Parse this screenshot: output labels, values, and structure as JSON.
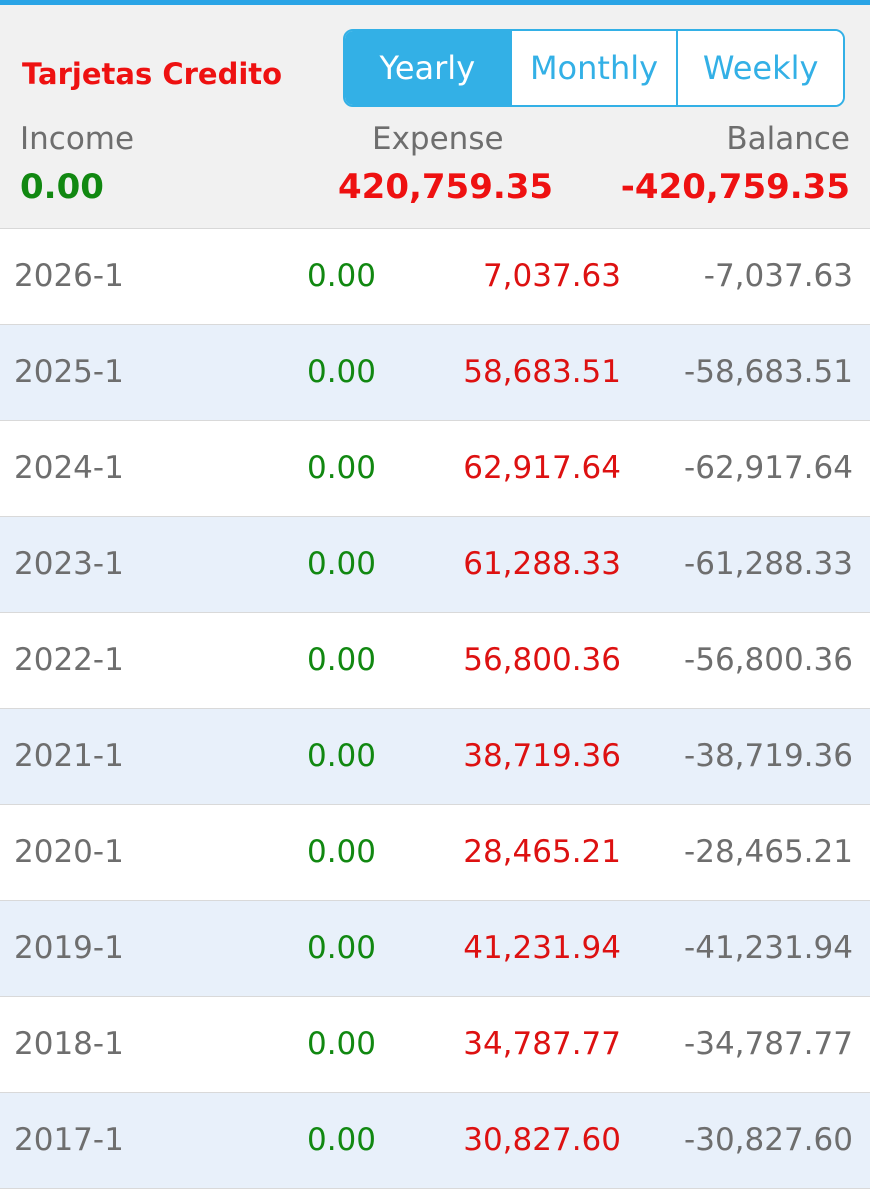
{
  "header": {
    "account_name": "Tarjetas Credito",
    "periods": [
      {
        "label": "Yearly",
        "active": true
      },
      {
        "label": "Monthly",
        "active": false
      },
      {
        "label": "Weekly",
        "active": false
      }
    ],
    "summary": {
      "income_label": "Income",
      "income_value": "0.00",
      "expense_label": "Expense",
      "expense_value": "420,759.35",
      "balance_label": "Balance",
      "balance_value": "-420,759.35"
    }
  },
  "colors": {
    "accent": "#33b0e6",
    "income": "#118811",
    "expense": "#ee1111",
    "muted": "#6e6e6e",
    "row_alt": "#e8f0fa"
  },
  "rows": [
    {
      "period": "2026-1",
      "income": "0.00",
      "expense": "7,037.63",
      "balance": "-7,037.63"
    },
    {
      "period": "2025-1",
      "income": "0.00",
      "expense": "58,683.51",
      "balance": "-58,683.51"
    },
    {
      "period": "2024-1",
      "income": "0.00",
      "expense": "62,917.64",
      "balance": "-62,917.64"
    },
    {
      "period": "2023-1",
      "income": "0.00",
      "expense": "61,288.33",
      "balance": "-61,288.33"
    },
    {
      "period": "2022-1",
      "income": "0.00",
      "expense": "56,800.36",
      "balance": "-56,800.36"
    },
    {
      "period": "2021-1",
      "income": "0.00",
      "expense": "38,719.36",
      "balance": "-38,719.36"
    },
    {
      "period": "2020-1",
      "income": "0.00",
      "expense": "28,465.21",
      "balance": "-28,465.21"
    },
    {
      "period": "2019-1",
      "income": "0.00",
      "expense": "41,231.94",
      "balance": "-41,231.94"
    },
    {
      "period": "2018-1",
      "income": "0.00",
      "expense": "34,787.77",
      "balance": "-34,787.77"
    },
    {
      "period": "2017-1",
      "income": "0.00",
      "expense": "30,827.60",
      "balance": "-30,827.60"
    }
  ]
}
